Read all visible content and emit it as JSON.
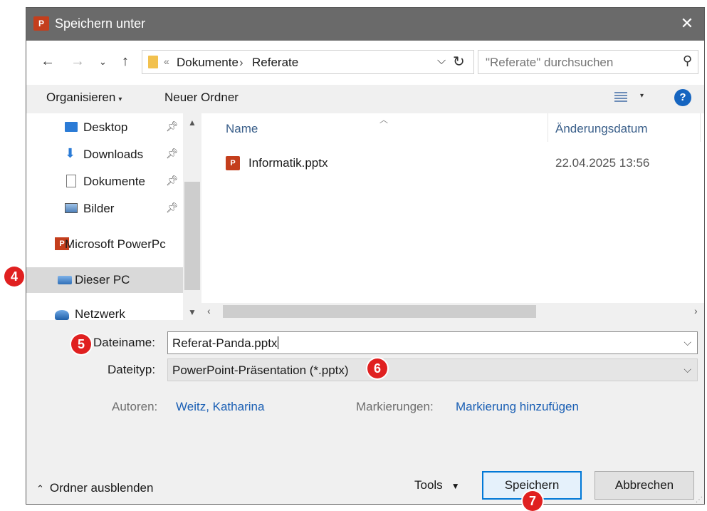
{
  "window": {
    "title": "Speichern unter",
    "app_icon": "powerpoint-icon",
    "close": "✕"
  },
  "address": {
    "path": [
      "Dokumente",
      "Referate"
    ],
    "overflow": "«",
    "separator": "›",
    "search_placeholder": "\"Referate\" durchsuchen"
  },
  "toolbar": {
    "organize": "Organisieren",
    "new_folder": "Neuer Ordner",
    "help": "?"
  },
  "nav": {
    "items": [
      {
        "label": "Desktop",
        "icon": "desktop-icon",
        "pinned": true
      },
      {
        "label": "Downloads",
        "icon": "download-arrow-icon",
        "pinned": true
      },
      {
        "label": "Dokumente",
        "icon": "document-icon",
        "pinned": true
      },
      {
        "label": "Bilder",
        "icon": "pictures-icon",
        "pinned": true
      },
      {
        "label": "Microsoft PowerPc",
        "icon": "powerpoint-icon",
        "pinned": false
      },
      {
        "label": "Dieser PC",
        "icon": "computer-icon",
        "pinned": false,
        "selected": true
      },
      {
        "label": "Netzwerk",
        "icon": "network-icon",
        "pinned": false
      }
    ]
  },
  "files": {
    "columns": {
      "name": "Name",
      "date": "Änderungsdatum"
    },
    "rows": [
      {
        "name": "Informatik.pptx",
        "date": "22.04.2025 13:56",
        "icon": "pptx-file-icon"
      }
    ]
  },
  "form": {
    "filename_label": "Dateiname:",
    "filename_value": "Referat-Panda.pptx",
    "filetype_label": "Dateityp:",
    "filetype_value": "PowerPoint-Präsentation (*.pptx)",
    "authors_label": "Autoren:",
    "authors_value": "Weitz, Katharina",
    "tags_label": "Markierungen:",
    "tags_value": "Markierung hinzufügen"
  },
  "footer": {
    "hide_folders": "Ordner ausblenden",
    "tools": "Tools",
    "save": "Speichern",
    "cancel": "Abbrechen"
  },
  "annotations": [
    "4",
    "5",
    "6",
    "7"
  ],
  "colors": {
    "badge": "#e02020",
    "accent": "#0078d7",
    "link": "#1a5fb4",
    "titlebar": "#6a6a6a"
  }
}
